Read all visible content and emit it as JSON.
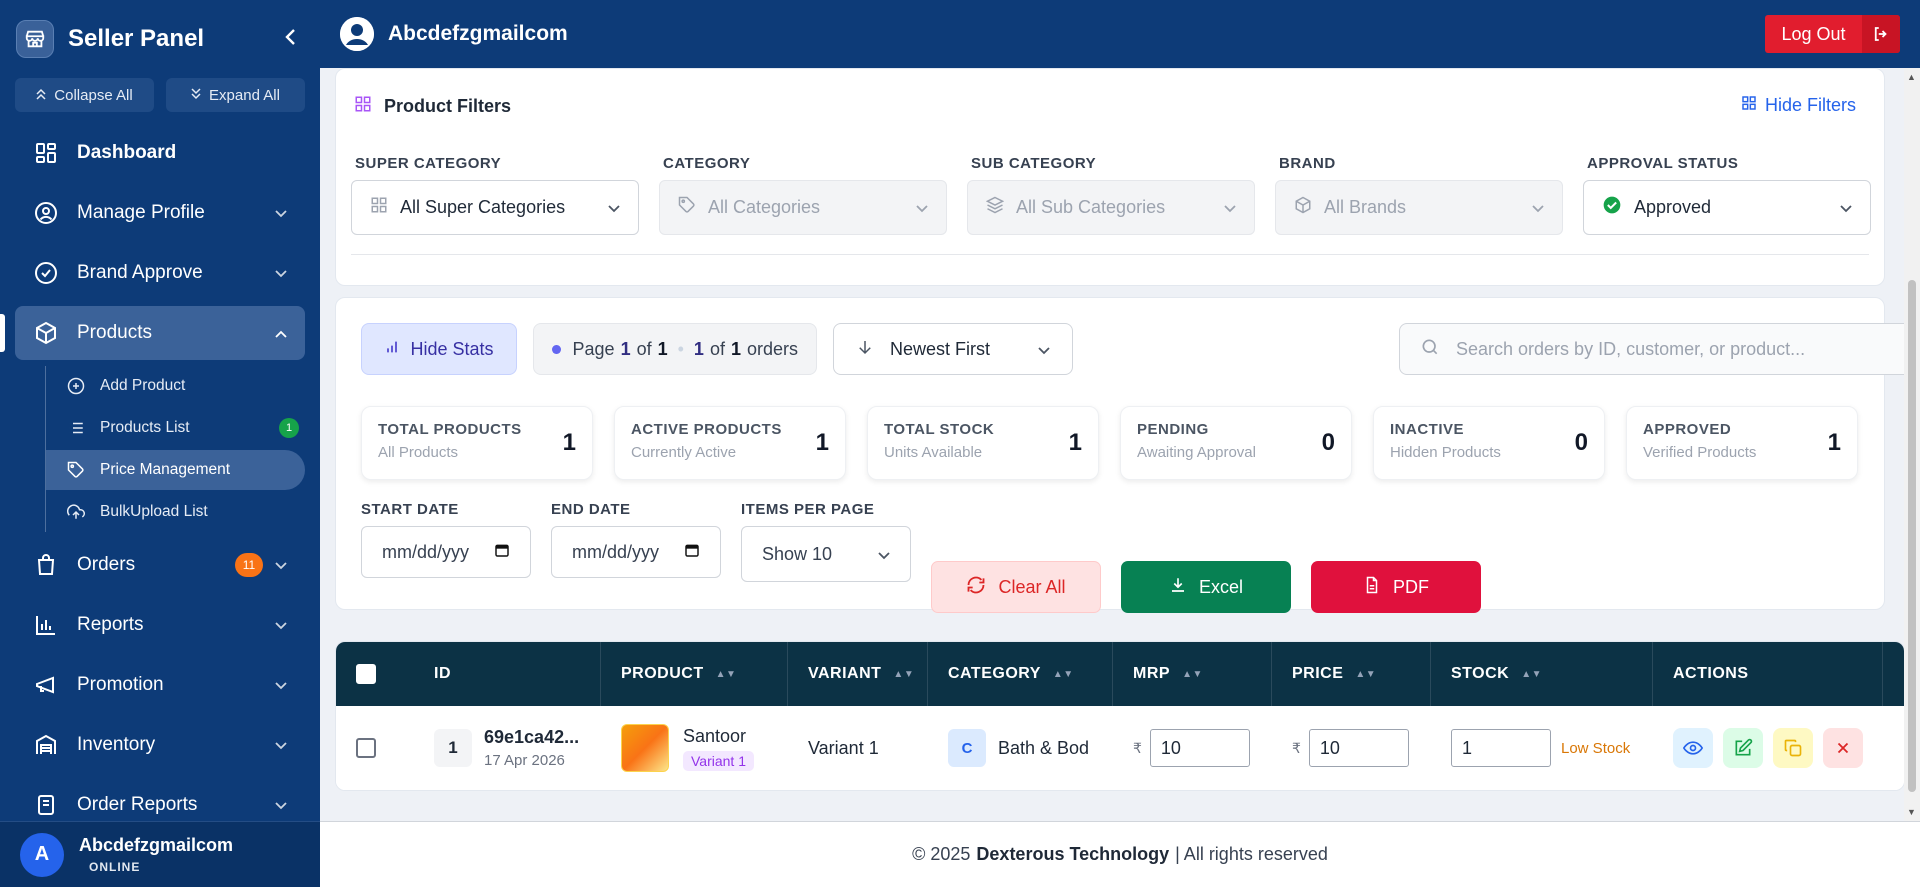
{
  "sidebar": {
    "title": "Seller Panel",
    "collapse_all": "Collapse All",
    "expand_all": "Expand All",
    "items": [
      {
        "label": "Dashboard",
        "icon": "dashboard-icon"
      },
      {
        "label": "Manage Profile",
        "icon": "profile-icon"
      },
      {
        "label": "Brand Approve",
        "icon": "check-circle-icon"
      },
      {
        "label": "Products",
        "icon": "box-icon"
      },
      {
        "label": "Orders",
        "icon": "bag-icon",
        "badge": "11"
      },
      {
        "label": "Reports",
        "icon": "bar-chart-icon"
      },
      {
        "label": "Promotion",
        "icon": "megaphone-icon"
      },
      {
        "label": "Inventory",
        "icon": "warehouse-icon"
      },
      {
        "label": "Order Reports",
        "icon": "report-icon"
      }
    ],
    "sub_items": [
      {
        "label": "Add Product",
        "icon": "plus-circle-icon"
      },
      {
        "label": "Products List",
        "icon": "list-icon",
        "badge": "1"
      },
      {
        "label": "Price Management",
        "icon": "tag-icon"
      },
      {
        "label": "BulkUpload List",
        "icon": "cloud-upload-icon"
      }
    ],
    "user": {
      "avatar": "A",
      "name": "Abcdefzgmailcom",
      "status": "ONLINE"
    }
  },
  "topbar": {
    "user": "Abcdefzgmailcom",
    "logout": "Log Out"
  },
  "filters": {
    "title": "Product Filters",
    "hide_label": "Hide Filters",
    "groups": [
      {
        "label": "SUPER CATEGORY",
        "value": "All Super Categories"
      },
      {
        "label": "CATEGORY",
        "value": "All Categories"
      },
      {
        "label": "SUB CATEGORY",
        "value": "All Sub Categories"
      },
      {
        "label": "BRAND",
        "value": "All Brands"
      },
      {
        "label": "APPROVAL STATUS",
        "value": "Approved"
      }
    ]
  },
  "toolbar": {
    "hide_stats": "Hide Stats",
    "page_prefix": "Page",
    "page_current": "1",
    "of": "of",
    "page_total": "1",
    "orders_current": "1",
    "orders_total": "1",
    "orders_suffix": "orders",
    "sort": "Newest First",
    "search_placeholder": "Search orders by ID, customer, or product..."
  },
  "stats": [
    {
      "title": "TOTAL PRODUCTS",
      "sub": "All Products",
      "value": "1"
    },
    {
      "title": "ACTIVE PRODUCTS",
      "sub": "Currently Active",
      "value": "1"
    },
    {
      "title": "TOTAL STOCK",
      "sub": "Units Available",
      "value": "1"
    },
    {
      "title": "PENDING",
      "sub": "Awaiting Approval",
      "value": "0"
    },
    {
      "title": "INACTIVE",
      "sub": "Hidden Products",
      "value": "0"
    },
    {
      "title": "APPROVED",
      "sub": "Verified Products",
      "value": "1"
    }
  ],
  "controls": {
    "start_date_label": "START DATE",
    "end_date_label": "END DATE",
    "items_per_page_label": "ITEMS PER PAGE",
    "date_placeholder": "mm/dd/yyy",
    "items_per_page": "Show 10",
    "clear_all": "Clear All",
    "excel": "Excel",
    "pdf": "PDF"
  },
  "table": {
    "headers": [
      "ID",
      "PRODUCT",
      "VARIANT",
      "CATEGORY",
      "MRP",
      "PRICE",
      "STOCK",
      "ACTIONS"
    ],
    "rows": [
      {
        "num": "1",
        "id": "69e1ca42...",
        "date": "17 Apr 2026",
        "product": "Santoor",
        "product_variant": "Variant 1",
        "variant": "Variant 1",
        "category_initial": "C",
        "category": "Bath & Bod",
        "currency": "₹",
        "mrp": "10",
        "price": "10",
        "stock": "1",
        "stock_status": "Low Stock"
      }
    ]
  },
  "footer": {
    "copyright": "© 2025",
    "company": "Dexterous Technology",
    "rights": "| All rights reserved"
  }
}
